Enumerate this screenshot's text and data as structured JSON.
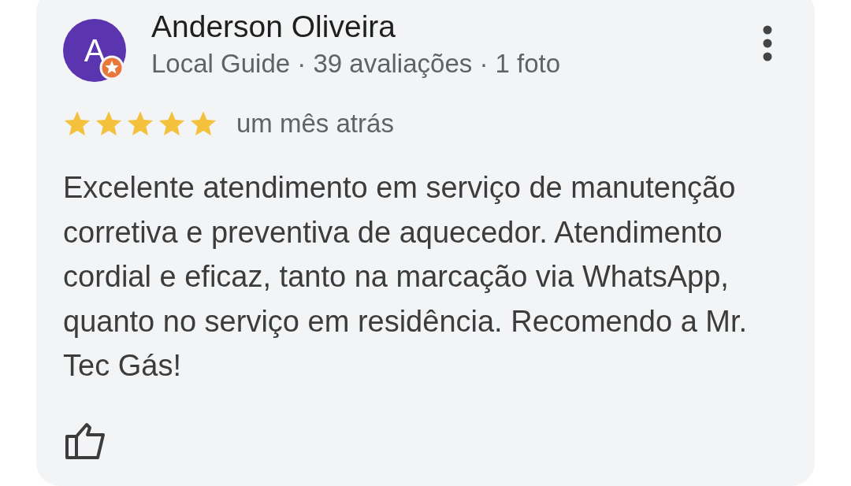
{
  "review": {
    "avatar_letter": "A",
    "local_guide_badge": true,
    "author": "Anderson Oliveira",
    "author_meta": "Local Guide · 39 avaliações · 1 foto",
    "stars": 5,
    "date": "um mês atrás",
    "text": "Excelente atendimento em serviço de manutenção corretiva e preventiva de aquecedor. Atendimento cordial e eficaz, tanto na marcação via WhatsApp, quanto no serviço em residência. Recomendo a Mr. Tec Gás!"
  }
}
